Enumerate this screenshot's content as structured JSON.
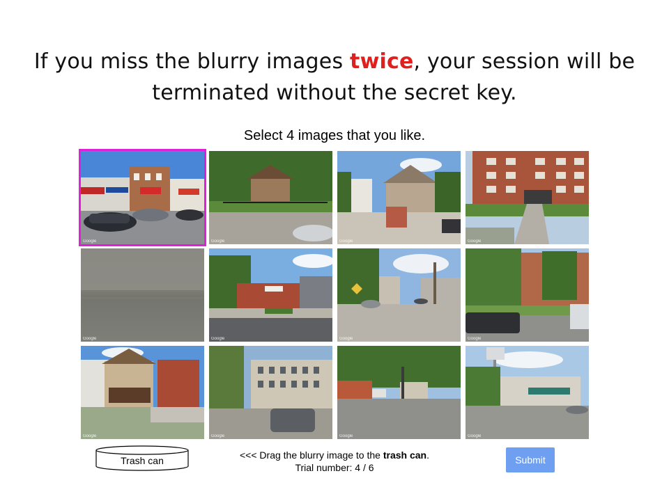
{
  "warning": {
    "before": "If you miss the blurry images ",
    "emphasis": "twice",
    "after": ", your session will be terminated without the secret key.",
    "emphasis_color": "#e0201e"
  },
  "instruction": "Select 4 images that you like.",
  "grid": {
    "selection_color": "#e020d8",
    "images": [
      {
        "id": "commercial-storefront-street",
        "watermark": "Google",
        "selected": true,
        "blurry": false
      },
      {
        "id": "trees-house-iron-fence",
        "watermark": "Google",
        "selected": false,
        "blurry": false
      },
      {
        "id": "victorian-houses-sidewalk",
        "watermark": "Google",
        "selected": false,
        "blurry": false
      },
      {
        "id": "brick-apartment-building-driveway",
        "watermark": "Google",
        "selected": false,
        "blurry": false
      },
      {
        "id": "blurry-gray-image",
        "watermark": "Google",
        "selected": false,
        "blurry": true
      },
      {
        "id": "corner-shops-street",
        "watermark": "Google",
        "selected": false,
        "blurry": false
      },
      {
        "id": "alley-parking-lot",
        "watermark": "Google",
        "selected": false,
        "blurry": false
      },
      {
        "id": "apartment-trees-pickup-truck",
        "watermark": "Google",
        "selected": false,
        "blurry": false
      },
      {
        "id": "two-story-houses-porch",
        "watermark": "Google",
        "selected": false,
        "blurry": false
      },
      {
        "id": "modern-building-suv",
        "watermark": "Google",
        "selected": false,
        "blurry": false
      },
      {
        "id": "tree-lined-street-stores",
        "watermark": "Google",
        "selected": false,
        "blurry": false
      },
      {
        "id": "shopping-plaza-tower",
        "watermark": "Google",
        "selected": false,
        "blurry": false
      }
    ]
  },
  "trash": {
    "label": "Trash can"
  },
  "footer": {
    "drag_before": "<<< Drag the blurry image to the ",
    "drag_bold": "trash can",
    "drag_after": ".",
    "trial_label": "Trial number: 4 / 6"
  },
  "submit_label": "Submit",
  "submit_color": "#6f9ff0"
}
